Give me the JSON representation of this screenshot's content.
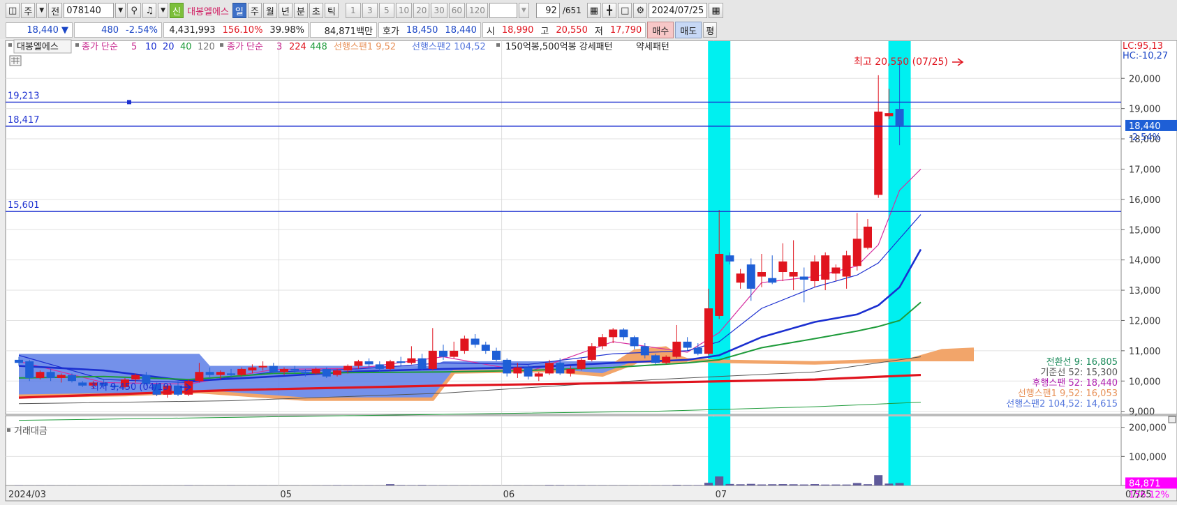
{
  "toolbar": {
    "market_toggle": "주",
    "prev_btn": "전",
    "code": "078140",
    "new_badge": "신",
    "stock_name": "대봉엘에스",
    "periods": [
      "일",
      "주",
      "월",
      "년",
      "분",
      "초",
      "틱"
    ],
    "minute_options": [
      "1",
      "3",
      "5",
      "10",
      "20",
      "30",
      "60",
      "120"
    ],
    "count_value": "92",
    "count_total": "/651",
    "date": "2024/07/25"
  },
  "quote": {
    "price": "18,440 ▼",
    "change": "480",
    "change_pct": "-2.54%",
    "volume": "4,431,993",
    "vol_ratio": "156.10%",
    "turnover": "39.98%",
    "amount": "84,871백만",
    "hoga_label": "호가",
    "ask": "18,450",
    "bid": "18,440",
    "open_label": "시",
    "open": "18,990",
    "high_label": "고",
    "high": "20,550",
    "low_label": "저",
    "low": "17,790",
    "buy_label": "매수",
    "sell_label": "매도",
    "eval_label": "평"
  },
  "legend": {
    "name": "대봉엘에스",
    "ma_label": "종가 단순",
    "ma_periods": [
      "5",
      "10",
      "20",
      "40",
      "120"
    ],
    "ma2_label": "종가 단순",
    "ma2_periods": [
      "3",
      "224",
      "448"
    ],
    "span1": "선행스팬1 9,52",
    "span2": "선행스팬2 104,52",
    "pattern": "150억봉,500억봉 강세패턴",
    "weak": "약세패턴"
  },
  "right_info": {
    "lc": "LC:95,13",
    "hc": "HC:-10,27"
  },
  "annotations": {
    "high_note": "최고 20,550 (07/25)",
    "low_note": "최저 9,450 (04/19)",
    "lines": [
      "19,213",
      "18,417",
      "15,601"
    ],
    "last_price": "18,440",
    "last_pct": "-2.54%"
  },
  "ichimoku_labels": [
    {
      "text": "전환선 9: 16,805",
      "color": "#1a8a5a"
    },
    {
      "text": "기준선 52: 15,300",
      "color": "#555555"
    },
    {
      "text": "후행스팬 52: 18,440",
      "color": "#b01fb0"
    },
    {
      "text": "선행스팬1 9,52: 16,053",
      "color": "#e8925a"
    },
    {
      "text": "선행스팬2 104,52: 14,615",
      "color": "#5577dd"
    }
  ],
  "volume_panel": {
    "title": "거래대금",
    "last_value": "84,871",
    "last_pct": "156.12%"
  },
  "colors": {
    "up": "#e0141e",
    "down": "#1e5fd6",
    "highlight": "#00f0f0",
    "cloud_blue": "#5c7ee6",
    "cloud_orange": "#f2a56a",
    "ma5": "#d62fa0",
    "ma10": "#1b2fd0",
    "ma20": "#1e9b3a",
    "ma120": "#555555",
    "ma224": "#e0141e"
  },
  "chart_data": {
    "type": "candlestick",
    "x_tick_labels": [
      "2024/03",
      "05",
      "06",
      "07",
      "07/25"
    ],
    "y_ticks": [
      9000,
      10000,
      11000,
      12000,
      13000,
      14000,
      15000,
      16000,
      17000,
      18000,
      19000,
      20000
    ],
    "y_tick_labels": [
      "9,000",
      "10,000",
      "11,000",
      "12,000",
      "13,000",
      "14,000",
      "15,000",
      "16,000",
      "17,000",
      "18,000",
      "19,000",
      "20,000"
    ],
    "ylim": [
      8900,
      21250
    ],
    "volume_ticks": [
      100000,
      200000
    ],
    "volume_tick_labels": [
      "100,000",
      "200,000"
    ],
    "volume_ylim": [
      0,
      240000
    ],
    "highlight_bars": [
      66,
      83
    ],
    "candles": [
      [
        10700,
        10800,
        10500,
        10600
      ],
      [
        10650,
        10700,
        10000,
        10100
      ],
      [
        10100,
        10350,
        10050,
        10300
      ],
      [
        10300,
        10400,
        10000,
        10100
      ],
      [
        10100,
        10250,
        9950,
        10200
      ],
      [
        10200,
        10250,
        9950,
        10000
      ],
      [
        9950,
        10000,
        9800,
        9850
      ],
      [
        9850,
        10000,
        9750,
        9950
      ],
      [
        9950,
        10050,
        9800,
        9850
      ],
      [
        9850,
        9950,
        9700,
        9800
      ],
      [
        9800,
        10100,
        9750,
        10050
      ],
      [
        10050,
        10250,
        9950,
        10200
      ],
      [
        10200,
        10300,
        9850,
        9900
      ],
      [
        9900,
        9950,
        9500,
        9550
      ],
      [
        9550,
        9900,
        9450,
        9850
      ],
      [
        9850,
        10000,
        9500,
        9550
      ],
      [
        9550,
        10050,
        9500,
        10000
      ],
      [
        10000,
        10600,
        9950,
        10300
      ],
      [
        10300,
        10450,
        10100,
        10200
      ],
      [
        10200,
        10350,
        10050,
        10300
      ],
      [
        10250,
        10400,
        10150,
        10200
      ],
      [
        10200,
        10450,
        10150,
        10400
      ],
      [
        10350,
        10550,
        10250,
        10450
      ],
      [
        10450,
        10650,
        10350,
        10500
      ],
      [
        10500,
        10600,
        10250,
        10300
      ],
      [
        10300,
        10450,
        10200,
        10400
      ],
      [
        10400,
        10500,
        10250,
        10350
      ],
      [
        10300,
        10400,
        10150,
        10250
      ],
      [
        10250,
        10450,
        10200,
        10400
      ],
      [
        10400,
        10450,
        10100,
        10150
      ],
      [
        10200,
        10400,
        10150,
        10350
      ],
      [
        10350,
        10550,
        10250,
        10500
      ],
      [
        10500,
        10700,
        10400,
        10650
      ],
      [
        10650,
        10750,
        10450,
        10550
      ],
      [
        10550,
        10650,
        10300,
        10400
      ],
      [
        10400,
        10700,
        10350,
        10650
      ],
      [
        10650,
        10800,
        10500,
        10600
      ],
      [
        10600,
        11150,
        10550,
        10750
      ],
      [
        10750,
        10900,
        10350,
        10400
      ],
      [
        10400,
        11750,
        10350,
        11000
      ],
      [
        11000,
        11200,
        10700,
        10800
      ],
      [
        10800,
        11300,
        10750,
        11000
      ],
      [
        11000,
        11500,
        10900,
        11400
      ],
      [
        11400,
        11550,
        11100,
        11200
      ],
      [
        11200,
        11300,
        10900,
        11000
      ],
      [
        11000,
        11100,
        10650,
        10700
      ],
      [
        10700,
        10750,
        10150,
        10250
      ],
      [
        10250,
        10600,
        10100,
        10450
      ],
      [
        10450,
        10550,
        10050,
        10150
      ],
      [
        10150,
        10300,
        10000,
        10250
      ],
      [
        10250,
        10700,
        10200,
        10600
      ],
      [
        10600,
        10750,
        10200,
        10250
      ],
      [
        10250,
        10500,
        10150,
        10400
      ],
      [
        10400,
        10750,
        10350,
        10700
      ],
      [
        10700,
        11250,
        10650,
        11150
      ],
      [
        11150,
        11550,
        11050,
        11450
      ],
      [
        11450,
        11750,
        11250,
        11700
      ],
      [
        11700,
        11750,
        11350,
        11450
      ],
      [
        11450,
        11500,
        11050,
        11150
      ],
      [
        11150,
        11250,
        10750,
        10850
      ],
      [
        10850,
        10900,
        10550,
        10600
      ],
      [
        10600,
        10850,
        10550,
        10800
      ],
      [
        10800,
        11850,
        10750,
        11300
      ],
      [
        11300,
        11450,
        11000,
        11100
      ],
      [
        11100,
        11250,
        10850,
        10900
      ],
      [
        10900,
        13050,
        10850,
        12400
      ],
      [
        12150,
        15650,
        12050,
        14200
      ],
      [
        14150,
        14250,
        13850,
        13950
      ],
      [
        13250,
        13700,
        13050,
        13550
      ],
      [
        13850,
        14050,
        12650,
        13050
      ],
      [
        13450,
        14200,
        13100,
        13600
      ],
      [
        13400,
        14150,
        13200,
        13250
      ],
      [
        13600,
        14550,
        13300,
        13950
      ],
      [
        13450,
        14650,
        13000,
        13600
      ],
      [
        13450,
        13750,
        12600,
        13350
      ],
      [
        13300,
        14150,
        13100,
        13950
      ],
      [
        13350,
        14250,
        13000,
        14150
      ],
      [
        13550,
        13850,
        13300,
        13750
      ],
      [
        13450,
        14300,
        13050,
        14150
      ],
      [
        13800,
        15550,
        13650,
        14700
      ],
      [
        14400,
        15350,
        14350,
        15100
      ],
      [
        16150,
        20100,
        16050,
        18900
      ],
      [
        18750,
        19650,
        18650,
        18850
      ],
      [
        18990,
        20550,
        17790,
        18440
      ]
    ],
    "volumes": [
      800,
      400,
      600,
      500,
      300,
      400,
      200,
      300,
      200,
      300,
      250,
      350,
      400,
      300,
      250,
      300,
      1200,
      500,
      400,
      300,
      800,
      300,
      400,
      500,
      350,
      300,
      400,
      300,
      500,
      800,
      1300,
      1000,
      700,
      900,
      600,
      4500,
      1600,
      1300,
      1800,
      1200,
      1000,
      800,
      600,
      700,
      500,
      600,
      400,
      500,
      700,
      400,
      1700,
      1500,
      1100,
      1300,
      1000,
      900,
      800,
      900,
      700,
      600,
      800,
      1200,
      2100,
      1500,
      1400,
      9200,
      31000,
      5200,
      4100,
      5500,
      3500,
      4200,
      4700,
      4100,
      3400,
      4700,
      3100,
      3300,
      3200,
      8400,
      4300,
      35500,
      6500,
      8500
    ],
    "ma": [
      {
        "name": "5",
        "color": "#d62fa0",
        "width": 1.2,
        "points": [
          [
            0,
            10650
          ],
          [
            8,
            9950
          ],
          [
            16,
            9900
          ],
          [
            24,
            10380
          ],
          [
            32,
            10420
          ],
          [
            40,
            10800
          ],
          [
            48,
            10300
          ],
          [
            56,
            11300
          ],
          [
            63,
            10950
          ],
          [
            66,
            11600
          ],
          [
            70,
            13250
          ],
          [
            75,
            13450
          ],
          [
            79,
            13800
          ],
          [
            81,
            14500
          ],
          [
            83,
            16300
          ],
          [
            85,
            17000
          ]
        ]
      },
      {
        "name": "10",
        "color": "#1b2fd0",
        "width": 1.2,
        "points": [
          [
            0,
            10850
          ],
          [
            8,
            10050
          ],
          [
            16,
            9950
          ],
          [
            24,
            10300
          ],
          [
            32,
            10400
          ],
          [
            40,
            10600
          ],
          [
            48,
            10550
          ],
          [
            56,
            10900
          ],
          [
            63,
            11000
          ],
          [
            66,
            11300
          ],
          [
            70,
            12400
          ],
          [
            75,
            13100
          ],
          [
            79,
            13500
          ],
          [
            81,
            13900
          ],
          [
            83,
            14700
          ],
          [
            85,
            15500
          ]
        ]
      },
      {
        "name": "20",
        "color": "#1b2fd0",
        "width": 2.6,
        "points": [
          [
            0,
            10500
          ],
          [
            8,
            10350
          ],
          [
            16,
            10000
          ],
          [
            24,
            10150
          ],
          [
            32,
            10320
          ],
          [
            40,
            10400
          ],
          [
            48,
            10450
          ],
          [
            56,
            10600
          ],
          [
            63,
            10700
          ],
          [
            66,
            10850
          ],
          [
            70,
            11450
          ],
          [
            75,
            11950
          ],
          [
            79,
            12200
          ],
          [
            81,
            12500
          ],
          [
            83,
            13100
          ],
          [
            85,
            14350
          ]
        ]
      },
      {
        "name": "40",
        "color": "#1e9b3a",
        "width": 2.0,
        "points": [
          [
            0,
            10100
          ],
          [
            8,
            10150
          ],
          [
            16,
            10050
          ],
          [
            24,
            10250
          ],
          [
            32,
            10280
          ],
          [
            40,
            10300
          ],
          [
            48,
            10350
          ],
          [
            56,
            10450
          ],
          [
            63,
            10600
          ],
          [
            66,
            10700
          ],
          [
            70,
            11100
          ],
          [
            75,
            11400
          ],
          [
            79,
            11650
          ],
          [
            81,
            11800
          ],
          [
            83,
            12000
          ],
          [
            85,
            12600
          ]
        ]
      },
      {
        "name": "120",
        "color": "#555555",
        "width": 1.0,
        "points": [
          [
            0,
            9250
          ],
          [
            20,
            9350
          ],
          [
            40,
            9600
          ],
          [
            60,
            10050
          ],
          [
            75,
            10300
          ],
          [
            85,
            10800
          ]
        ]
      },
      {
        "name": "224",
        "color": "#e0141e",
        "width": 3.2,
        "points": [
          [
            0,
            9450
          ],
          [
            20,
            9700
          ],
          [
            40,
            9850
          ],
          [
            60,
            9950
          ],
          [
            75,
            10050
          ],
          [
            85,
            10200
          ]
        ]
      },
      {
        "name": "448",
        "color": "#1e9b3a",
        "width": 1.0,
        "points": [
          [
            0,
            8700
          ],
          [
            20,
            8800
          ],
          [
            40,
            8900
          ],
          [
            60,
            9000
          ],
          [
            75,
            9150
          ],
          [
            85,
            9300
          ]
        ]
      }
    ],
    "cloud": {
      "span2": [
        [
          0,
          10900
        ],
        [
          17,
          10900
        ],
        [
          18,
          10500
        ],
        [
          39,
          10500
        ],
        [
          40,
          10650
        ],
        [
          61,
          10650
        ],
        [
          62,
          10650
        ],
        [
          84,
          10650
        ],
        [
          90,
          10650
        ]
      ],
      "span1": [
        [
          0,
          9500
        ],
        [
          10,
          9550
        ],
        [
          17,
          9650
        ],
        [
          27,
          9400
        ],
        [
          39,
          9400
        ],
        [
          41,
          10300
        ],
        [
          50,
          10350
        ],
        [
          55,
          10200
        ],
        [
          58,
          10600
        ],
        [
          60,
          11050
        ],
        [
          63,
          10700
        ],
        [
          66,
          10650
        ],
        [
          75,
          10600
        ],
        [
          84,
          10700
        ],
        [
          87,
          11000
        ],
        [
          90,
          11050
        ]
      ]
    }
  }
}
